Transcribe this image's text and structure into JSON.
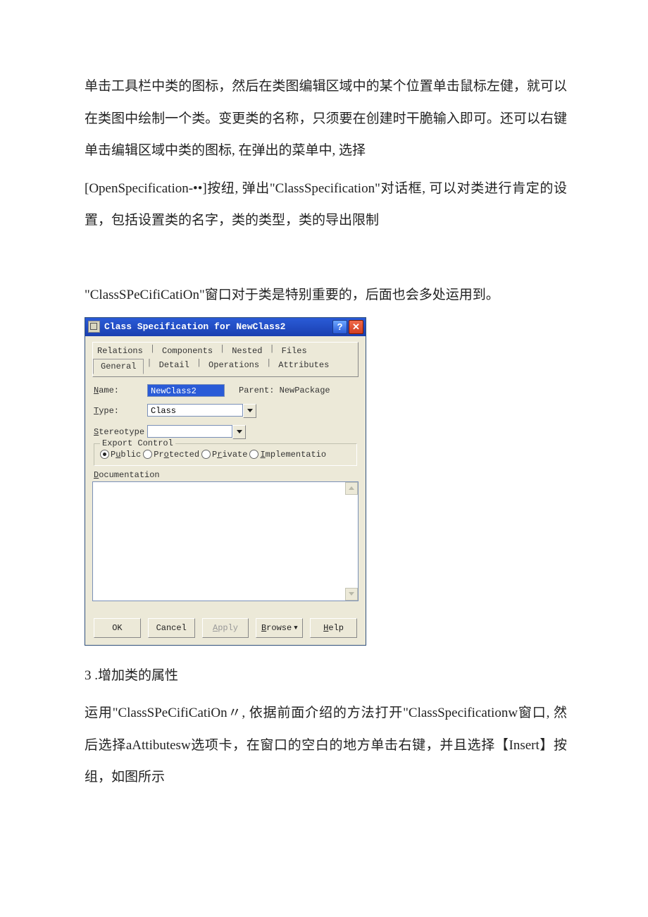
{
  "para1": "单击工具栏中类的图标，然后在类图编辑区域中的某个位置单击鼠标左健，就可以在类图中绘制一个类。变更类的名称，只须要在创建时干脆输入即可。还可以右键单击编辑区域中类的图标, 在弹出的菜单中, 选择",
  "para2": "[OpenSpecification-••]按纽, 弹出\"ClassSpecification\"对话框, 可以对类进行肯定的设置，包括设置类的名字，类的类型，类的导出限制",
  "para3": "\"ClassSPeCifiCatiOn\"窗口对于类是特别重要的，后面也会多处运用到。",
  "dialog": {
    "title": "Class Specification for NewClass2",
    "tabs_top": {
      "relations": "Relations",
      "components": "Components",
      "nested": "Nested",
      "files": "Files"
    },
    "tabs_bottom": {
      "general": "General",
      "detail": "Detail",
      "operations": "Operations",
      "attributes": "Attributes"
    },
    "name_label": "Name:",
    "name_value": "NewClass2",
    "parent_label": "Parent:",
    "parent_value": "NewPackage",
    "type_label": "Type:",
    "type_value": "Class",
    "stereo_label": "Stereotype",
    "stereo_value": "",
    "export_label": "Export Control",
    "radios": {
      "public": "Public",
      "protected": "Protected",
      "private": "Private",
      "impl": "Implementatio"
    },
    "doc_label": "Documentation",
    "buttons": {
      "ok": "OK",
      "cancel": "Cancel",
      "apply": "Apply",
      "browse": "Browse ▾",
      "help": "Help"
    }
  },
  "para4": "3 .增加类的属性",
  "para5": "运用\"ClassSPeCifiCatiOn〃, 依据前面介绍的方法打开\"ClassSpecificationw窗口, 然后选择aAttibutesw选项卡，在窗口的空白的地方单击右键，并且选择【Insert】按组，如图所示"
}
